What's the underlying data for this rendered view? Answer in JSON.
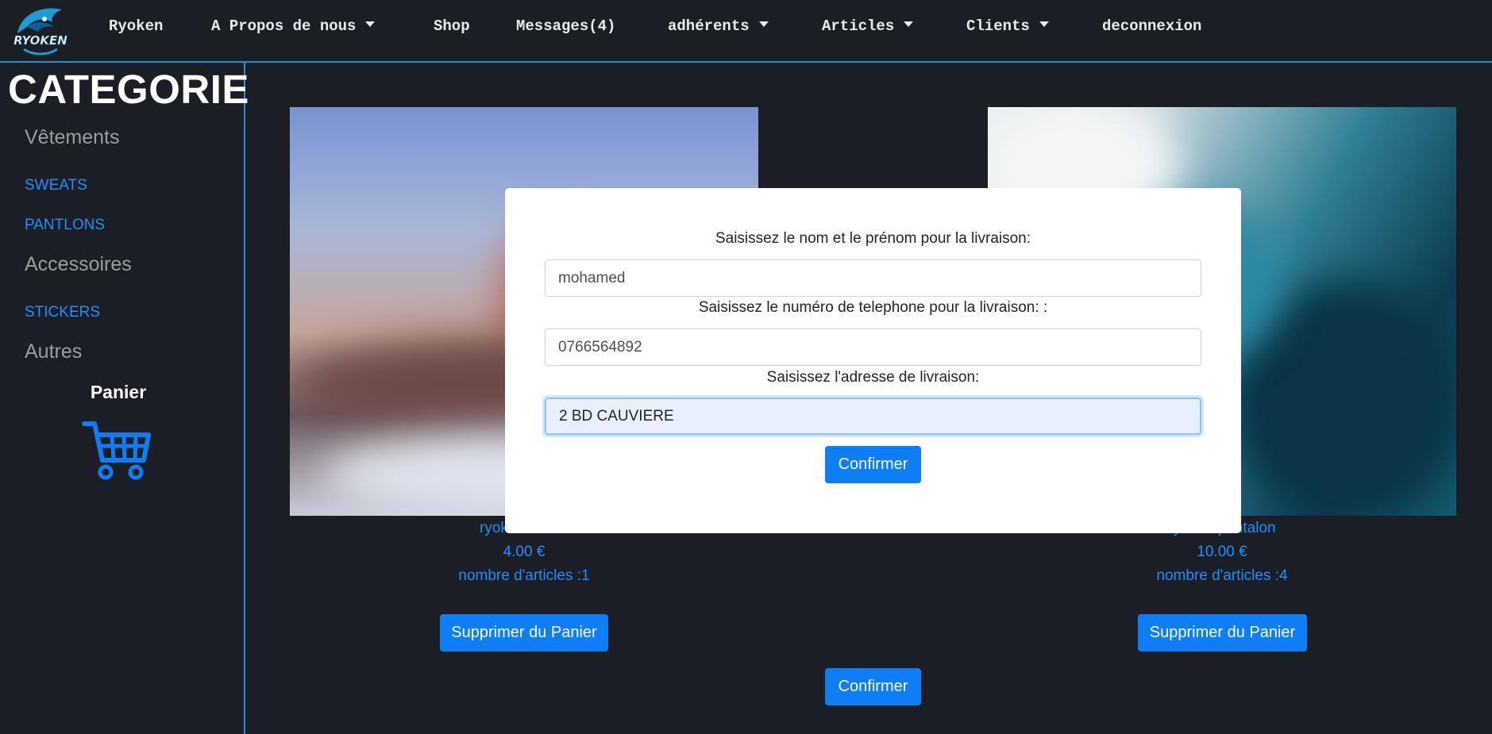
{
  "nav": {
    "logo_text": "RYOKEN",
    "items": [
      {
        "label": "Ryoken",
        "dropdown": false
      },
      {
        "label": "A Propos de nous",
        "dropdown": true
      },
      {
        "label": "Shop",
        "dropdown": false
      },
      {
        "label": "Messages(4)",
        "dropdown": false
      },
      {
        "label": "adhérents",
        "dropdown": true
      },
      {
        "label": "Articles",
        "dropdown": true
      },
      {
        "label": "Clients",
        "dropdown": true
      },
      {
        "label": "deconnexion",
        "dropdown": false
      }
    ]
  },
  "sidebar": {
    "title": "CATEGORIE",
    "groups": [
      {
        "name": "Vêtements",
        "links": [
          "SWEATS",
          "PANTLONS"
        ]
      },
      {
        "name": "Accessoires",
        "links": [
          "STICKERS"
        ]
      },
      {
        "name": "Autres",
        "links": []
      }
    ],
    "panier_label": "Panier",
    "cart_icon": "shopping-cart-icon"
  },
  "products": [
    {
      "name": "ryoken sweat",
      "price": "4.00 €",
      "count": "nombre d'articles :1",
      "remove_label": "Supprimer du Panier"
    },
    {
      "name": "ryoken pantalon",
      "price": "10.00 €",
      "count": "nombre d'articles :4",
      "remove_label": "Supprimer du Panier"
    }
  ],
  "confirm_label": "Confirmer",
  "modal": {
    "name_label": "Saisissez le nom et le prénom pour la livraison:",
    "name_value": "mohamed",
    "phone_label": "Saisissez le numéro de telephone pour la livraison: :",
    "phone_value": "0766564892",
    "address_label": "Saisissez l'adresse de livraison:",
    "address_value": "2 BD CAUVIERE",
    "confirm_label": "Confirmer"
  },
  "colors": {
    "background": "#1b1e24",
    "accent": "#1e90d6",
    "link": "#1e8fff",
    "button": "#0d7ef5"
  }
}
